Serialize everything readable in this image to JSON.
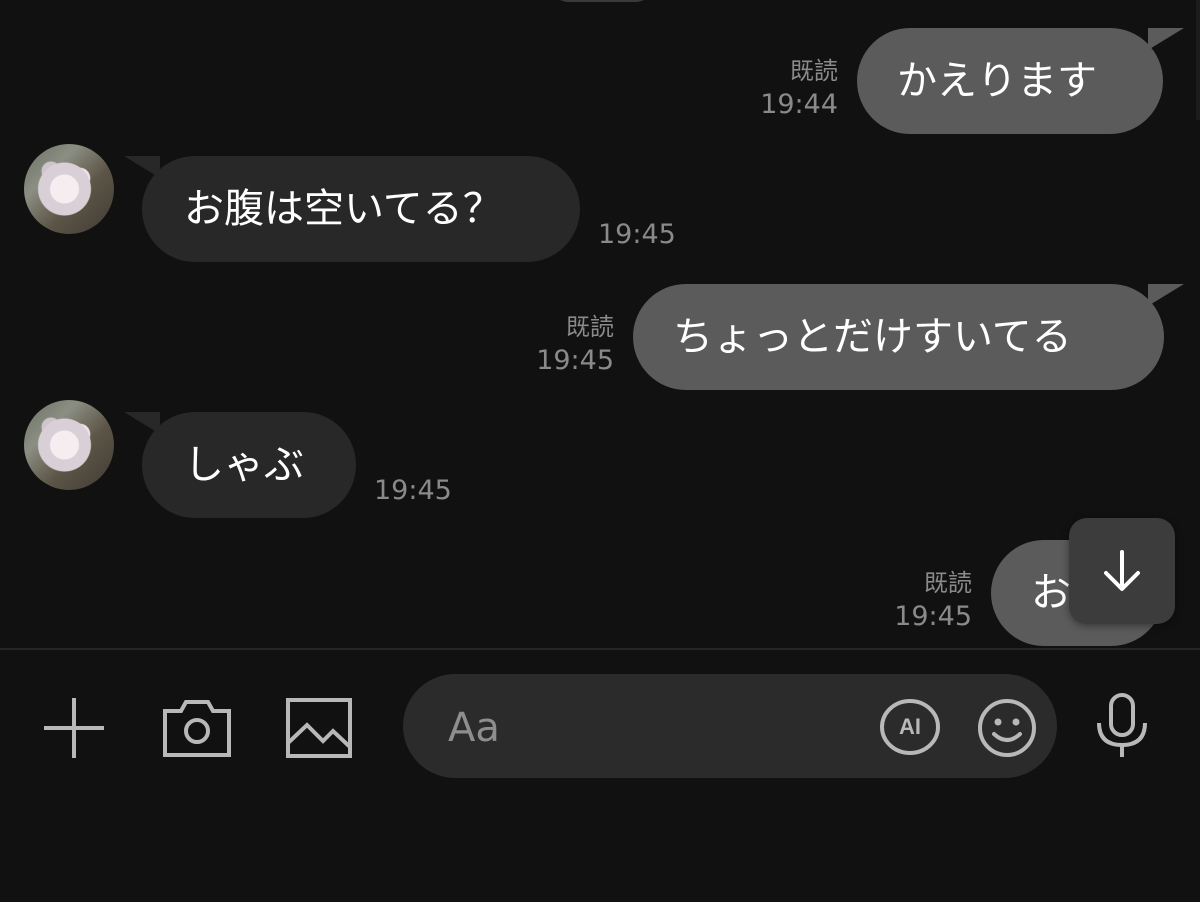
{
  "messages": [
    {
      "direction": "sent",
      "text": "かえります",
      "read_label": "既読",
      "time": "19:44"
    },
    {
      "direction": "received",
      "text": "お腹は空いてる？",
      "time": "19:45"
    },
    {
      "direction": "sent",
      "text": "ちょっとだけすいてる",
      "read_label": "既読",
      "time": "19:45"
    },
    {
      "direction": "received",
      "text": "しゃぶ",
      "time": "19:45"
    },
    {
      "direction": "sent",
      "text": "お",
      "read_label": "既読",
      "time": "19:45"
    }
  ],
  "scroll_button": {
    "icon": "arrow-down-icon"
  },
  "input_bar": {
    "placeholder": "Aa",
    "ai_label": "AI",
    "icons": [
      "plus-icon",
      "camera-icon",
      "image-icon",
      "ai-icon",
      "emoji-icon",
      "microphone-icon"
    ]
  },
  "colors": {
    "background": "#111111",
    "sent_bubble": "#5b5b5b",
    "received_bubble": "#282828",
    "meta_text": "#8a8a8a",
    "input_field": "#2b2b2b"
  }
}
